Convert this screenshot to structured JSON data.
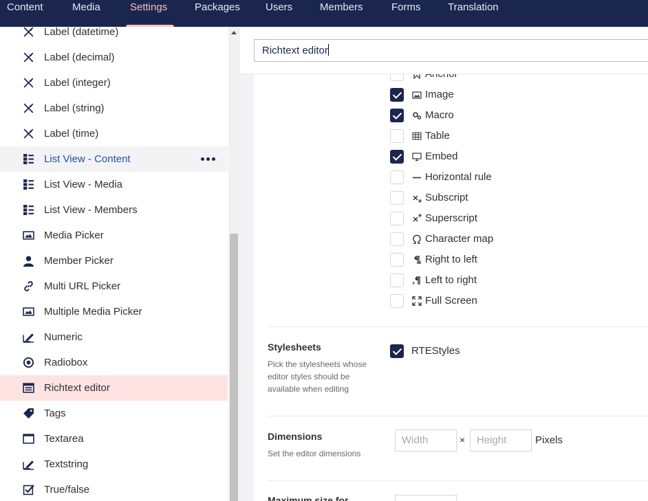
{
  "topnav": {
    "tabs": [
      {
        "label": "Content"
      },
      {
        "label": "Media"
      },
      {
        "label": "Settings"
      },
      {
        "label": "Packages"
      },
      {
        "label": "Users"
      },
      {
        "label": "Members"
      },
      {
        "label": "Forms"
      },
      {
        "label": "Translation"
      }
    ],
    "active": "Settings"
  },
  "sidebar": {
    "items": [
      {
        "label": "Label (datetime)",
        "icon": "label-icon"
      },
      {
        "label": "Label (decimal)",
        "icon": "label-icon"
      },
      {
        "label": "Label (integer)",
        "icon": "label-icon"
      },
      {
        "label": "Label (string)",
        "icon": "label-icon"
      },
      {
        "label": "Label (time)",
        "icon": "label-icon"
      },
      {
        "label": "List View - Content",
        "icon": "list-view-icon",
        "state": "hover"
      },
      {
        "label": "List View - Media",
        "icon": "list-view-icon"
      },
      {
        "label": "List View - Members",
        "icon": "list-view-icon"
      },
      {
        "label": "Media Picker",
        "icon": "picture-icon"
      },
      {
        "label": "Member Picker",
        "icon": "user-icon"
      },
      {
        "label": "Multi URL Picker",
        "icon": "link-icon"
      },
      {
        "label": "Multiple Media Picker",
        "icon": "picture-icon"
      },
      {
        "label": "Numeric",
        "icon": "autofill-icon"
      },
      {
        "label": "Radiobox",
        "icon": "target-icon"
      },
      {
        "label": "Richtext editor",
        "icon": "browser-window-icon",
        "state": "selected"
      },
      {
        "label": "Tags",
        "icon": "tags-icon"
      },
      {
        "label": "Textarea",
        "icon": "application-window-icon"
      },
      {
        "label": "Textstring",
        "icon": "autofill-icon"
      },
      {
        "label": "True/false",
        "icon": "checkbox-icon"
      }
    ]
  },
  "editor": {
    "name_value": "Richtext editor",
    "toolbar_options": [
      {
        "label": "Anchor",
        "checked": false,
        "icon": "anchor-icon"
      },
      {
        "label": "Image",
        "checked": true,
        "icon": "image-icon"
      },
      {
        "label": "Macro",
        "checked": true,
        "icon": "cogs-icon"
      },
      {
        "label": "Table",
        "checked": false,
        "icon": "table-icon"
      },
      {
        "label": "Embed",
        "checked": true,
        "icon": "monitor-icon"
      },
      {
        "label": "Horizontal rule",
        "checked": false,
        "icon": "horizontal-rule-icon"
      },
      {
        "label": "Subscript",
        "checked": false,
        "icon": "subscript-icon"
      },
      {
        "label": "Superscript",
        "checked": false,
        "icon": "superscript-icon"
      },
      {
        "label": "Character map",
        "checked": false,
        "icon": "omega-icon"
      },
      {
        "label": "Right to left",
        "checked": false,
        "icon": "rtl-icon"
      },
      {
        "label": "Left to right",
        "checked": false,
        "icon": "ltr-icon"
      },
      {
        "label": "Full Screen",
        "checked": false,
        "icon": "fullscreen-icon"
      }
    ],
    "stylesheets": {
      "title": "Stylesheets",
      "description": "Pick the stylesheets whose editor styles should be available when editing",
      "options": [
        {
          "label": "RTEStyles",
          "checked": true
        }
      ]
    },
    "dimensions": {
      "title": "Dimensions",
      "description": "Set the editor dimensions",
      "width_placeholder": "Width",
      "height_placeholder": "Height",
      "separator": "×",
      "unit": "Pixels"
    },
    "max_size": {
      "title": "Maximum size for"
    }
  }
}
